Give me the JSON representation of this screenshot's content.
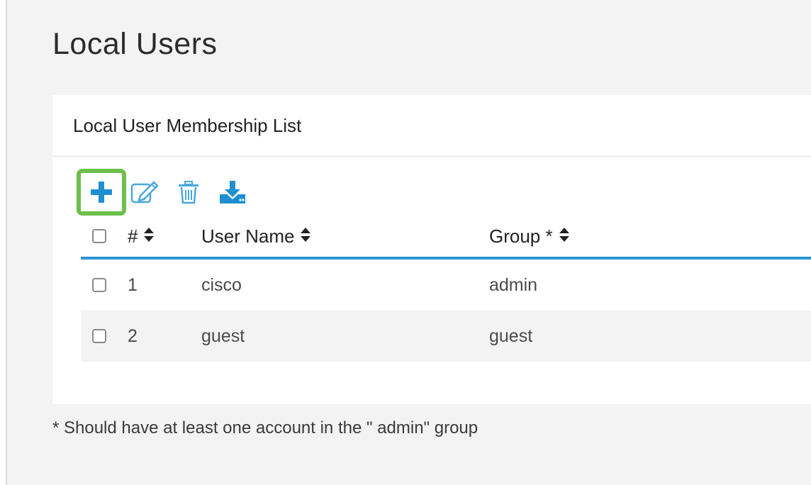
{
  "page": {
    "title": "Local Users",
    "footnote": "* Should have at least one account in the \" admin\"  group"
  },
  "panel": {
    "title": "Local User Membership List"
  },
  "toolbar": {
    "icons": [
      "plus-icon",
      "edit-icon",
      "trash-icon",
      "download-icon"
    ]
  },
  "table": {
    "headers": {
      "number": "#",
      "user_name": "User Name",
      "group": "Group *"
    },
    "rows": [
      {
        "number": "1",
        "user_name": "cisco",
        "group": "admin"
      },
      {
        "number": "2",
        "user_name": "guest",
        "group": "guest"
      }
    ]
  },
  "colors": {
    "accent": "#1e8fd0",
    "highlight": "#6cc04a",
    "header_rule": "#2d97d5"
  }
}
